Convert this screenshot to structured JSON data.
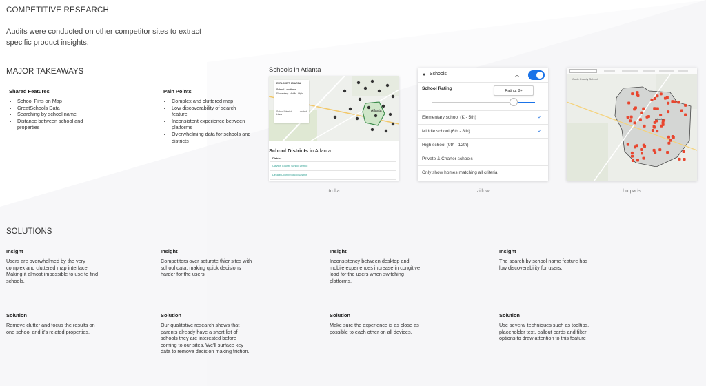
{
  "heading": "COMPETITIVE RESEARCH",
  "intro": [
    "Audits were conducted on other competitor sites to extract",
    "specific product insights."
  ],
  "takeaways": {
    "title": "MAJOR TAKEAWAYS",
    "shared": {
      "title": "Shared Features",
      "items": [
        "School Pins on Map",
        "GreatSchools Data",
        "Searching by school name",
        "Distance between school and properties"
      ]
    },
    "pain": {
      "title": "Pain Points",
      "items": [
        "Complex and cluttered map",
        "Low discoverability of search feature",
        "Inconsistent experience between platforms",
        "Overwhelming data for schools and districts"
      ]
    }
  },
  "screens": {
    "trulia": {
      "caption": "trulia",
      "title": "Schools in Atlanta",
      "subtitle_bold": "School Districts",
      "subtitle_rest": " in Atlanta",
      "table_header": "District",
      "rows": [
        "Clayton County School District",
        "Dekalb County School District"
      ],
      "map_label": "Atlanta",
      "panel": {
        "explore": "EXPLORE THIS AREA",
        "heading": "School Locations",
        "opts": [
          "Elementary",
          "Middle",
          "High"
        ],
        "boundary": "School District Lines",
        "located": "Located"
      }
    },
    "zillow": {
      "caption": "zillow",
      "header": "Schools",
      "rating_label": "School Rating",
      "rating_value": "Rating: 8+",
      "options": [
        {
          "label": "Elementary school (K - 5th)",
          "checked": true
        },
        {
          "label": "Middle school (6th - 8th)",
          "checked": true
        },
        {
          "label": "High school (9th - 12th)",
          "checked": false
        },
        {
          "label": "Private & Charter schools",
          "checked": false
        },
        {
          "label": "Only show homes matching all criteria",
          "checked": false
        }
      ],
      "accent": "#1a73e8"
    },
    "hotpads": {
      "caption": "hotpads",
      "county": "Cobb County School",
      "city": "Atlanta",
      "pin_color": "#e8462f"
    }
  },
  "solutions": {
    "title": "SOLUTIONS",
    "columns": [
      {
        "insight_label": "Insight",
        "insight": "Users are overwhelmed by the very complex and cluttered map interface. Making it almost impossible to use to find schools.",
        "solution_label": "Solution",
        "solution": "Remove clutter and focus the results on one school and it's related properties."
      },
      {
        "insight_label": "Insight",
        "insight": "Competitors over saturate thier sites with school data, making quick decisions harder for the users.",
        "solution_label": "Solution",
        "solution": "Our qualitative research shows that parents already have a short list of schools they are interested before coming to our sites. We'll surface key data to remove decision making friction."
      },
      {
        "insight_label": "Insight",
        "insight": "Inconsistency between desktop and mobile experiences increase in congitive load for the users when switching platforms.",
        "solution_label": "Solution",
        "solution": "Make sure the experience is as close as possible to each other on all devices."
      },
      {
        "insight_label": "Insight",
        "insight": "The search by school name feature has low discoverability for users.",
        "solution_label": "Solution",
        "solution": "Use several techniques such as tooltips, placeholder text, callout cards and filter options to draw attention to this feature"
      }
    ]
  }
}
